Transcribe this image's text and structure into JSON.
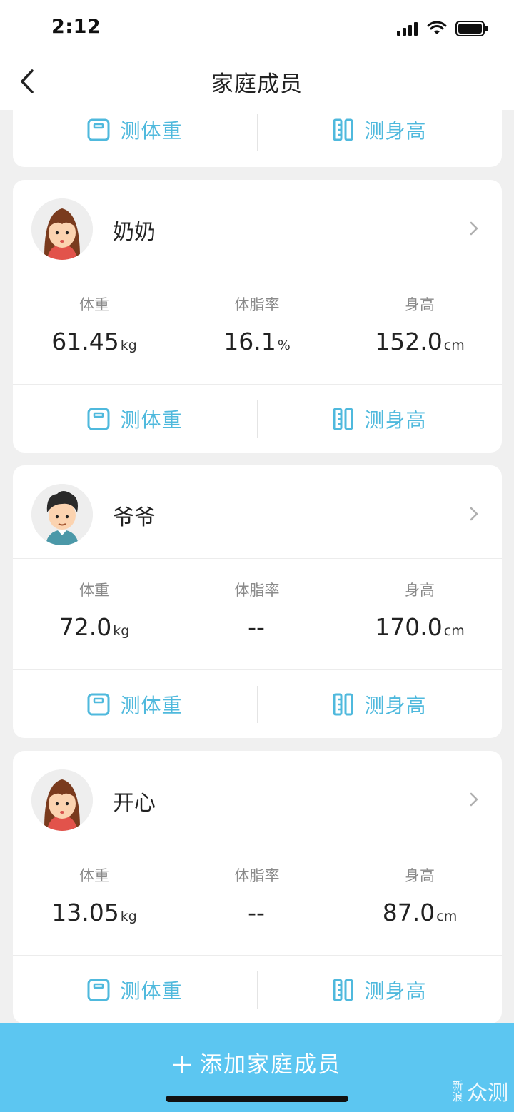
{
  "status_bar": {
    "time": "2:12"
  },
  "nav": {
    "title": "家庭成员"
  },
  "actions": {
    "weigh_label": "测体重",
    "height_label": "测身高"
  },
  "stat_labels": {
    "weight": "体重",
    "body_fat": "体脂率",
    "height": "身高"
  },
  "members": [
    {
      "name": "奶奶",
      "avatar": "girl-avatar",
      "weight": {
        "value": "61.45",
        "unit": "kg"
      },
      "body_fat": {
        "value": "16.1",
        "unit": "%"
      },
      "height": {
        "value": "152.0",
        "unit": "cm"
      }
    },
    {
      "name": "爷爷",
      "avatar": "boy-avatar",
      "weight": {
        "value": "72.0",
        "unit": "kg"
      },
      "body_fat": {
        "value": "--",
        "unit": ""
      },
      "height": {
        "value": "170.0",
        "unit": "cm"
      }
    },
    {
      "name": "开心",
      "avatar": "girl-avatar",
      "weight": {
        "value": "13.05",
        "unit": "kg"
      },
      "body_fat": {
        "value": "--",
        "unit": ""
      },
      "height": {
        "value": "87.0",
        "unit": "cm"
      }
    }
  ],
  "add_button": {
    "label": "添加家庭成员"
  },
  "watermark": {
    "small_top": "新",
    "small_bottom": "浪",
    "big": "众测"
  },
  "colors": {
    "accent": "#4fb9dd",
    "add_bar": "#5cc6f1",
    "background": "#f0f0f0"
  }
}
